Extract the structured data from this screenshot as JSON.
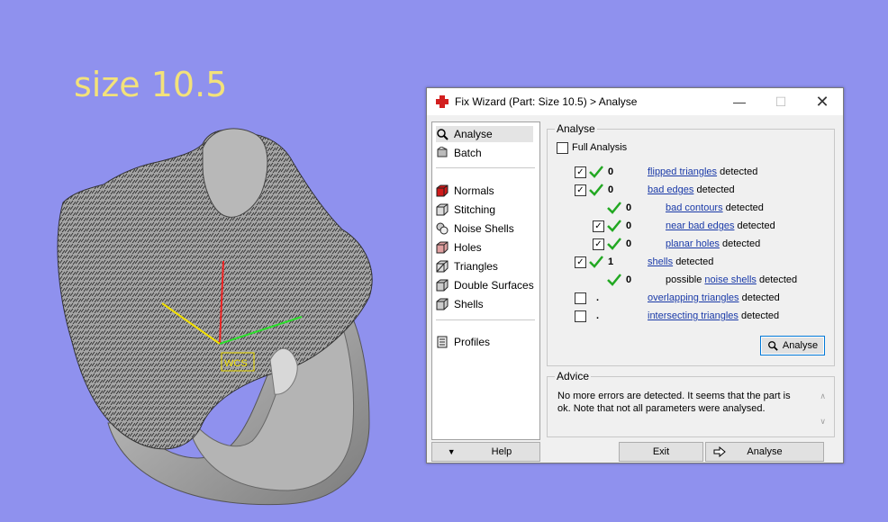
{
  "overlay_label": "size 10.5",
  "viewport": {
    "axis_label": "WCS"
  },
  "dialog": {
    "title": "Fix Wizard (Part: Size 10.5) > Analyse",
    "nav": {
      "analyse": "Analyse",
      "batch": "Batch",
      "normals": "Normals",
      "stitching": "Stitching",
      "noise_shells": "Noise Shells",
      "holes": "Holes",
      "triangles": "Triangles",
      "double_surfaces": "Double Surfaces",
      "shells": "Shells",
      "profiles": "Profiles"
    },
    "analyse_group": {
      "title": "Analyse",
      "full_analysis": "Full Analysis",
      "rows": [
        {
          "count": "0",
          "link": "flipped triangles",
          "suffix": "detected",
          "checked": true
        },
        {
          "count": "0",
          "link": "bad edges",
          "suffix": "detected",
          "checked": true
        },
        {
          "count": "0",
          "link": "bad contours",
          "suffix": "detected",
          "checked": null
        },
        {
          "count": "0",
          "link": "near bad edges",
          "suffix": "detected",
          "checked": true
        },
        {
          "count": "0",
          "link": "planar holes",
          "suffix": "detected",
          "checked": true
        },
        {
          "count": "1",
          "link": "shells",
          "suffix": "detected",
          "checked": true
        },
        {
          "count": "0",
          "prefix": "possible",
          "link": "noise shells",
          "suffix": "detected",
          "checked": null
        },
        {
          "count": ".",
          "link": "overlapping triangles",
          "suffix": "detected",
          "checked": false
        },
        {
          "count": ".",
          "link": "intersecting triangles",
          "suffix": "detected",
          "checked": false
        }
      ],
      "analyse_button": "Analyse"
    },
    "advice": {
      "title": "Advice",
      "text": "No more errors are detected. It seems that the part is ok. Note that not all parameters were analysed."
    },
    "bottom": {
      "help": "Help",
      "exit": "Exit",
      "analyse": "Analyse"
    }
  },
  "colors": {
    "background": "#8f91ee",
    "label": "#f3e27a",
    "link": "#1a3aa8",
    "check": "#22a822"
  }
}
